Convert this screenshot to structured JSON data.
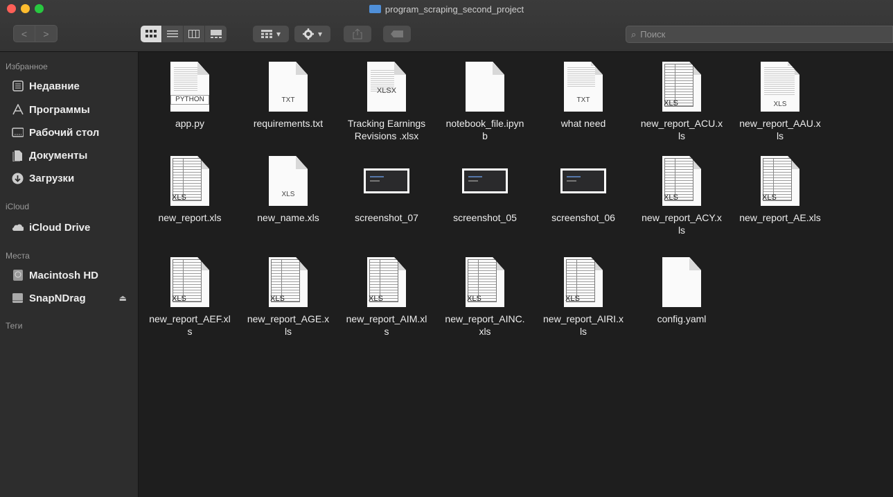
{
  "window": {
    "title": "program_scraping_second_project"
  },
  "toolbar": {
    "back_glyph": "<",
    "forward_glyph": ">",
    "view_buttons": [
      "icon-view",
      "list-view",
      "column-view",
      "gallery-view"
    ],
    "arrange_glyph": "▾",
    "action_glyph": "▾",
    "search_placeholder": "Поиск",
    "search_glyph": "⌕"
  },
  "sidebar": {
    "favorites_title": "Избранное",
    "favorites": [
      {
        "label": "Недавние",
        "icon": "recents-icon"
      },
      {
        "label": "Программы",
        "icon": "applications-icon"
      },
      {
        "label": "Рабочий стол",
        "icon": "desktop-icon"
      },
      {
        "label": "Документы",
        "icon": "documents-icon"
      },
      {
        "label": "Загрузки",
        "icon": "downloads-icon"
      }
    ],
    "icloud_title": "iCloud",
    "icloud": [
      {
        "label": "iCloud Drive",
        "icon": "cloud-icon"
      }
    ],
    "places_title": "Места",
    "places": [
      {
        "label": "Macintosh HD",
        "icon": "hard-drive-icon"
      },
      {
        "label": "SnapNDrag",
        "icon": "disk-icon",
        "eject": "⏏"
      }
    ],
    "tags_title": "Теги"
  },
  "files": [
    {
      "name": "app.py",
      "name2": "",
      "kind": "python",
      "badge": "PYTHON"
    },
    {
      "name": "requirements.txt",
      "name2": "",
      "kind": "txt",
      "badge": "TXT"
    },
    {
      "name": "Tracking Earnings",
      "name2": "Revisions .xlsx",
      "kind": "xlsx",
      "badge": "XLSX"
    },
    {
      "name": "notebook_file.ipyn",
      "name2": "b",
      "kind": "blank",
      "badge": ""
    },
    {
      "name": "what need",
      "name2": "",
      "kind": "txt-lines",
      "badge": "TXT"
    },
    {
      "name": "new_report_ACU.x",
      "name2": "ls",
      "kind": "xls-grid",
      "badge": "XLS"
    },
    {
      "name": "new_report_AAU.x",
      "name2": "ls",
      "kind": "xls-light",
      "badge": "XLS"
    },
    {
      "name": "new_report.xls",
      "name2": "",
      "kind": "xls-grid",
      "badge": "XLS"
    },
    {
      "name": "new_name.xls",
      "name2": "",
      "kind": "xls-plain",
      "badge": "XLS"
    },
    {
      "name": "screenshot_07",
      "name2": "",
      "kind": "shot",
      "badge": ""
    },
    {
      "name": "screenshot_05",
      "name2": "",
      "kind": "shot",
      "badge": ""
    },
    {
      "name": "screenshot_06",
      "name2": "",
      "kind": "shot",
      "badge": ""
    },
    {
      "name": "new_report_ACY.x",
      "name2": "ls",
      "kind": "xls-grid",
      "badge": "XLS"
    },
    {
      "name": "new_report_AE.xls",
      "name2": "",
      "kind": "xls-grid",
      "badge": "XLS"
    },
    {
      "name": "new_report_AEF.xl",
      "name2": "s",
      "kind": "xls-grid",
      "badge": "XLS"
    },
    {
      "name": "new_report_AGE.x",
      "name2": "ls",
      "kind": "xls-grid",
      "badge": "XLS"
    },
    {
      "name": "new_report_AIM.xl",
      "name2": "s",
      "kind": "xls-grid",
      "badge": "XLS"
    },
    {
      "name": "new_report_AINC.",
      "name2": "xls",
      "kind": "xls-grid",
      "badge": "XLS"
    },
    {
      "name": "new_report_AIRI.x",
      "name2": "ls",
      "kind": "xls-grid",
      "badge": "XLS"
    },
    {
      "name": "config.yaml",
      "name2": "",
      "kind": "blank",
      "badge": ""
    }
  ],
  "colors": {
    "close": "#fe5f57",
    "minimize": "#febc2e",
    "zoom": "#28c840",
    "folder": "#4f8fd8"
  }
}
